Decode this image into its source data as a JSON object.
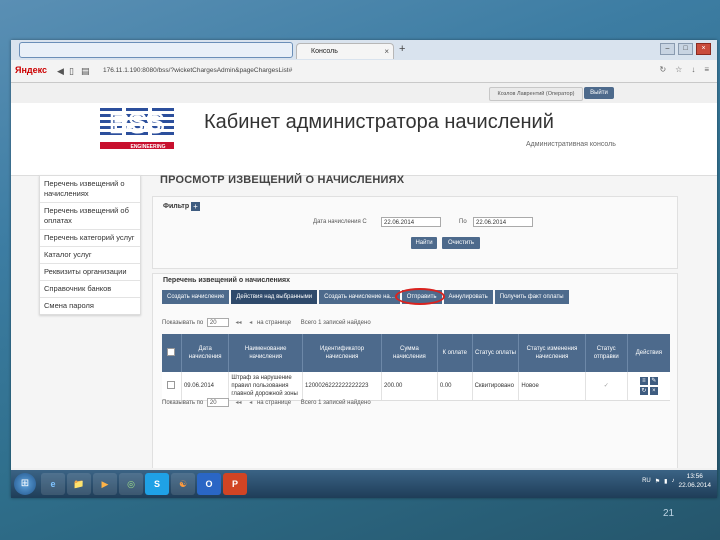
{
  "browser": {
    "tab_title": "Консоль администратора",
    "tab_close": "×",
    "new_tab": "+",
    "brand": "Яндекс",
    "url": "176.11.1.190:8080/bss/?wicketChargesAdmin&pageChargesList#",
    "window_controls": [
      "–",
      "□",
      "×"
    ]
  },
  "topbar": {
    "user_name": "Козлов Лаврентий (Оператор)",
    "logout_label": "Выйти"
  },
  "header": {
    "logo_text": "BSS",
    "logo_sub": "ENGINEERING",
    "title": "Кабинет администратора начислений",
    "subtitle": "Административная консоль"
  },
  "sidebar": {
    "items": [
      "Перечень извещений о начислениях",
      "Перечень извещений об оплатах",
      "Перечень категорий услуг",
      "Каталог услуг",
      "Реквизиты организации",
      "Справочник банков",
      "Смена пароля"
    ]
  },
  "main": {
    "page_title": "ПРОСМОТР ИЗВЕЩЕНИЙ О НАЧИСЛЕНИЯХ",
    "filter": {
      "label": "Фильтр",
      "toggle": "+",
      "date_from_label": "Дата начисления С",
      "date_from": "22.06.2014",
      "date_to_label": "По",
      "date_to": "22.06.2014",
      "find_button": "Найти",
      "clear_button": "Очистить"
    },
    "list": {
      "title": "Перечень извещений о начислениях",
      "toolbar": [
        "Создать начисление",
        "Действия над выбранными",
        "Создать начисление на...",
        "Отправить",
        "Аннулировать",
        "Получить факт оплаты"
      ],
      "pager_top": {
        "show_label": "Показывать по",
        "per_page": "20",
        "per_page_suffix": "на странице",
        "info": "Всего 1 записей найдено"
      },
      "pager_bottom": {
        "show_label": "Показывать по",
        "per_page": "20",
        "per_page_suffix": "на странице",
        "info": "Всего 1 записей найдено"
      },
      "columns": [
        "Дата начисления",
        "Наименование начисления",
        "Идентификатор начисления",
        "Сумма начисления",
        "К оплате",
        "Статус оплаты",
        "Статус изменения начисления",
        "Статус отправки",
        "Действия"
      ],
      "rows": [
        {
          "date": "09.06.2014",
          "name": "Штраф за нарушение правил пользования главной дорожной зоны",
          "id": "1200026222222222223",
          "amount": "200.00",
          "to_pay": "0.00",
          "pay_status": "Сквитировано",
          "change_status": "Новое",
          "send_status": "✓"
        }
      ]
    }
  },
  "taskbar": {
    "start": "⊞",
    "apps": [
      "e",
      "📁",
      "▶",
      "◎",
      "S",
      "☯",
      "O",
      "P"
    ],
    "lang": "RU",
    "time": "13:56",
    "date": "22.06.2014"
  },
  "slide": {
    "number": "21"
  }
}
